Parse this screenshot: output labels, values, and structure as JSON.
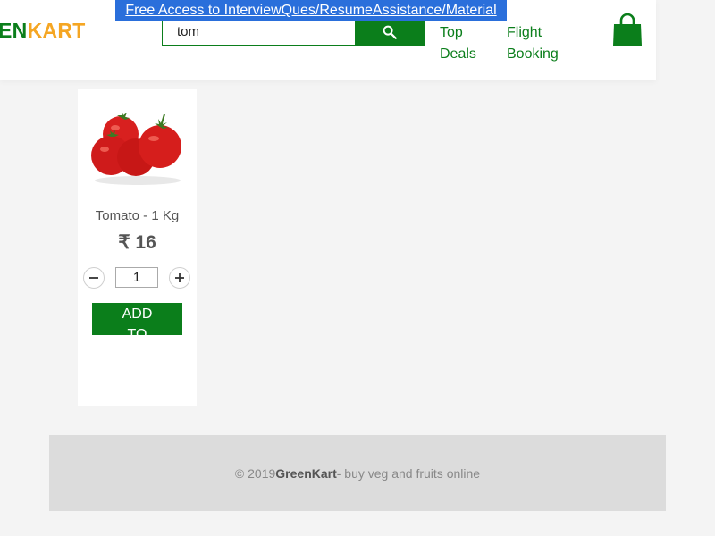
{
  "header": {
    "logo_part1": "EN",
    "logo_part2": "KART",
    "promo_banner": "Free Access to InterviewQues/ResumeAssistance/Material",
    "search": {
      "value": "tom",
      "placeholder": ""
    },
    "nav": {
      "top_deals_line1": "Top",
      "top_deals_line2": "Deals",
      "flight_line1": "Flight",
      "flight_line2": "Booking"
    }
  },
  "product": {
    "name": "Tomato - 1 Kg",
    "price": "₹ 16",
    "quantity": "1",
    "add_to_cart": "ADD TO CART"
  },
  "footer": {
    "prefix": "© 2019 ",
    "brand": "GreenKart",
    "suffix": " - buy veg and fruits online"
  },
  "colors": {
    "brand_green": "#0b7e1b",
    "brand_orange": "#f5a623",
    "banner_blue": "#2a6fdb"
  },
  "icons": {
    "search": "search-icon",
    "cart": "cart-bag-icon",
    "minus": "minus-icon",
    "plus": "plus-icon"
  }
}
